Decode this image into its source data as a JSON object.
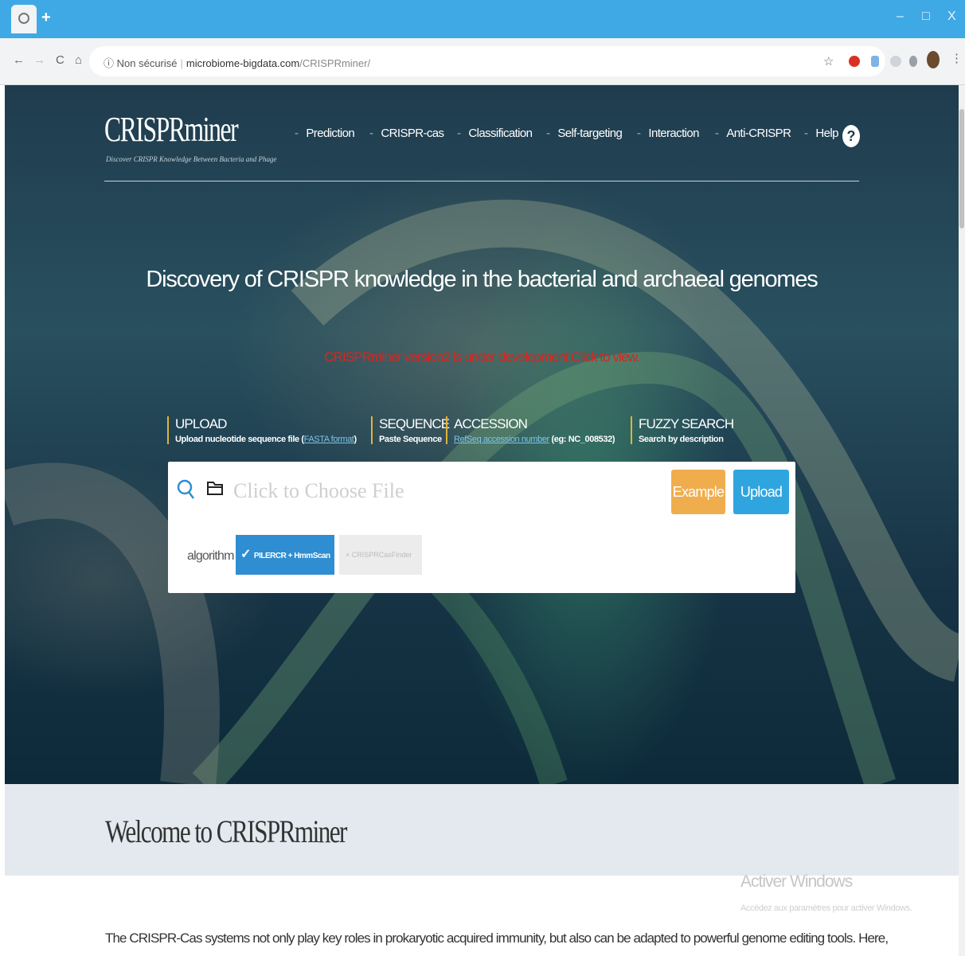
{
  "browser": {
    "new_tab": "+",
    "minimize": "–",
    "maximize": "□",
    "close": "X",
    "back": "←",
    "forward": "→",
    "reload": "C",
    "home": "⌂",
    "security_label": "Non sécurisé",
    "url_host": "microbiome-bigdata.com",
    "url_path": "/CRISPRminer/",
    "bookmark_star": "☆"
  },
  "header": {
    "logo": "CRISPRminer",
    "tagline": "Discover CRISPR Knowledge Between Bacteria and Phage",
    "nav": [
      "Prediction",
      "CRISPR-cas",
      "Classification",
      "Self-targeting",
      "Interaction",
      "Anti-CRISPR",
      "Help"
    ]
  },
  "hero": {
    "headline": "Discovery of CRISPR knowledge in the bacterial and archaeal genomes",
    "notice": "CRISPRminer version2 is under development.Click to view."
  },
  "search_tabs": [
    {
      "title": "UPLOAD",
      "sub_prefix": "Upload nucleotide sequence file (",
      "link": "FASTA format",
      "sub_suffix": ")"
    },
    {
      "title": "SEQUENCE",
      "sub_prefix": "Paste Sequence",
      "link": "",
      "sub_suffix": ""
    },
    {
      "title": "ACCESSION",
      "sub_prefix": "",
      "link": "RefSeq accession number",
      "sub_suffix": " (eg: NC_008532)"
    },
    {
      "title": "FUZZY SEARCH",
      "sub_prefix": "Search by description",
      "link": "",
      "sub_suffix": ""
    }
  ],
  "panel": {
    "file_placeholder": "Click to Choose File",
    "example_label": "Example",
    "upload_label": "Upload",
    "algorithm_label": "algorithm",
    "algo_option_1": "PILERCR + HmmScan",
    "algo_option_2": "CRISPRCasFinder"
  },
  "welcome": {
    "title": "Welcome to CRISPRminer",
    "intro": "The CRISPR-Cas systems not only play key roles in prokaryotic acquired immunity, but also can be adapted to powerful genome editing tools. Here,"
  },
  "watermark": {
    "title": "Activer Windows",
    "subtitle": "Accédez aux paramètres pour activer Windows."
  },
  "colors": {
    "chrome_blue": "#3fa9e6",
    "notice_red": "#d9251d",
    "example_orange": "#f0ad4e",
    "upload_blue": "#2fa5df",
    "tab_accent": "#e2b23a"
  }
}
